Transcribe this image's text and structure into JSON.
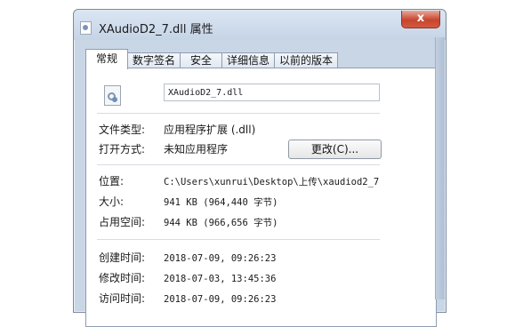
{
  "window": {
    "title": "XAudioD2_7.dll 属性",
    "close_glyph": "x"
  },
  "tabs": [
    {
      "label": "常规",
      "active": true
    },
    {
      "label": "数字签名",
      "active": false
    },
    {
      "label": "安全",
      "active": false
    },
    {
      "label": "详细信息",
      "active": false
    },
    {
      "label": "以前的版本",
      "active": false
    }
  ],
  "general": {
    "file_name": "XAudioD2_7.dll",
    "file_type_label": "文件类型:",
    "file_type_value": "应用程序扩展 (.dll)",
    "open_with_label": "打开方式:",
    "open_with_value": "未知应用程序",
    "change_button": "更改(C)...",
    "location_label": "位置:",
    "location_value": "C:\\Users\\xunrui\\Desktop\\上传\\xaudiod2_7",
    "size_label": "大小:",
    "size_value": "941 KB (964,440 字节)",
    "size_on_disk_label": "占用空间:",
    "size_on_disk_value": "944 KB (966,656 字节)",
    "created_label": "创建时间:",
    "created_value": "2018-07-09, 09:26:23",
    "modified_label": "修改时间:",
    "modified_value": "2018-07-03, 13:45:36",
    "accessed_label": "访问时间:",
    "accessed_value": "2018-07-09, 09:26:23"
  },
  "icons": {
    "title": "dll-file-icon",
    "file": "dll-file-icon"
  }
}
